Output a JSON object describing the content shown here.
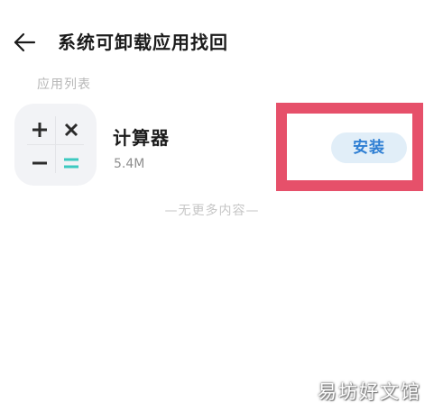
{
  "header": {
    "back_icon": "arrow-left-icon",
    "title": "系统可卸载应用找回"
  },
  "section": {
    "label": "应用列表"
  },
  "apps": [
    {
      "name": "计算器",
      "size": "5.4M",
      "icon": "calculator-icon",
      "action_label": "安装",
      "action_color": "#2f7fd3",
      "action_background": "#e1eef8"
    }
  ],
  "list_end": {
    "text": "—无更多内容—"
  },
  "highlight": {
    "color": "#e6506a"
  },
  "watermark": {
    "text": "易坊好文馆"
  }
}
